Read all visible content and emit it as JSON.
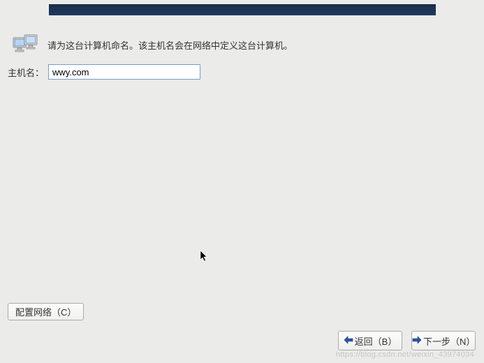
{
  "instruction_text": "请为这台计算机命名。该主机名会在网络中定义这台计算机。",
  "hostname": {
    "label": "主机名：",
    "value": "wwy.com"
  },
  "buttons": {
    "configure_network": "配置网络（C）",
    "back": "返回（B）",
    "next": "下一步（N）"
  },
  "watermark": "https://blog.csdn.net/weixin_43974034"
}
